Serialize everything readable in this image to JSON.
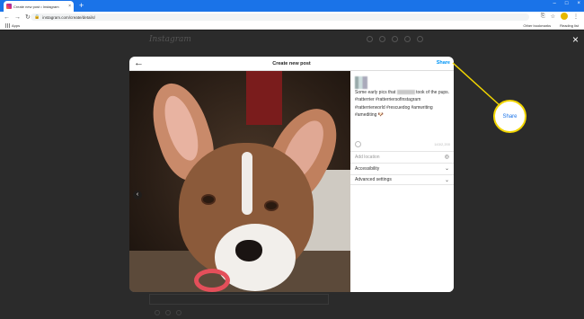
{
  "browser": {
    "tab_title": "Create new post • Instagram",
    "tab_close": "×",
    "new_tab": "+",
    "window_controls": [
      "–",
      "□",
      "×"
    ],
    "nav": {
      "back": "←",
      "forward": "→",
      "reload": "↻",
      "home": "⌂"
    },
    "url": "instagram.com/create/details/",
    "lock": "🔒",
    "toolbar_icons": [
      "⎘",
      "☆",
      "⋮"
    ],
    "bookmarks": {
      "apps": "Apps",
      "other": "Other bookmarks",
      "reading": "Reading list"
    }
  },
  "page": {
    "logo": "Instagram",
    "close": "×"
  },
  "modal": {
    "back": "←",
    "title": "Create new post",
    "share": "Share",
    "carousel_prev": "‹",
    "caption_start": "Some early pics that ",
    "caption_end": " took of the pups.",
    "hashtags": "#ratterrier #ratterriersofinstagram #ratterrierworld #rescuedog #amwriting #amediting 🐶",
    "char_count": "143/2,200",
    "options": {
      "location": "Add location",
      "location_icon": "◎",
      "accessibility": "Accessibility",
      "advanced": "Advanced settings",
      "chevron": "⌄"
    }
  },
  "callout": {
    "label": "Share"
  },
  "colors": {
    "accent": "#0095f6",
    "callout_border": "#f2d600",
    "chrome": "#1a73e8"
  }
}
